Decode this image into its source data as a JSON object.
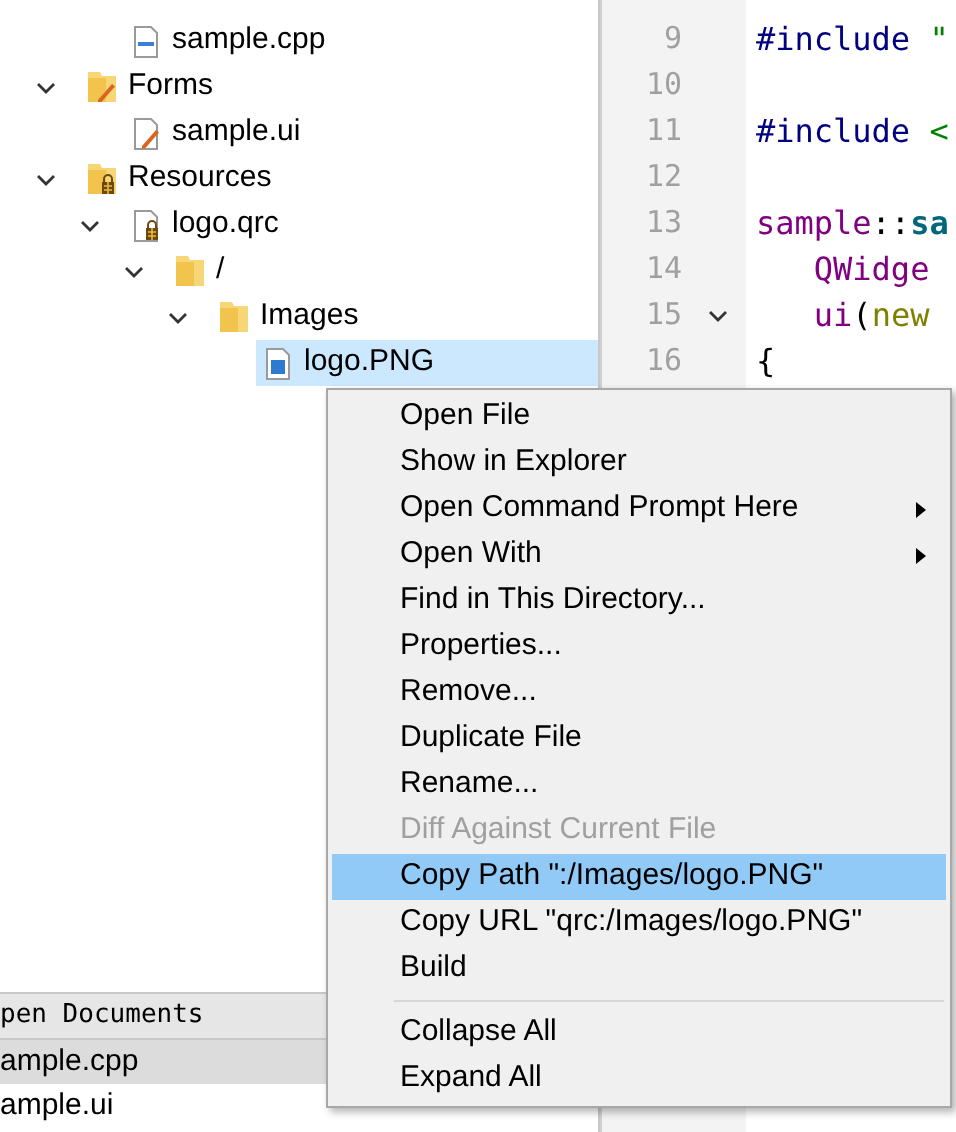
{
  "tree": {
    "continued_children": [
      {
        "label": "sample.cpp",
        "kind": "cpp",
        "selected": false
      }
    ],
    "items": [
      {
        "label": "Forms",
        "kind": "form-folder",
        "expanded": true,
        "selected": false,
        "children": [
          {
            "label": "sample.ui",
            "kind": "ui",
            "selected": false
          }
        ]
      },
      {
        "label": "Resources",
        "kind": "resource-folder",
        "expanded": true,
        "selected": false,
        "children": [
          {
            "label": "logo.qrc",
            "kind": "qrc",
            "expanded": true,
            "selected": false,
            "children": [
              {
                "label": "/",
                "kind": "folder",
                "expanded": true,
                "selected": false,
                "children": [
                  {
                    "label": "Images",
                    "kind": "folder",
                    "expanded": true,
                    "selected": false,
                    "children": [
                      {
                        "label": "logo.PNG",
                        "kind": "image",
                        "selected": true
                      }
                    ]
                  }
                ]
              }
            ]
          }
        ]
      }
    ]
  },
  "open_documents": {
    "title": "pen Documents",
    "items": [
      {
        "label": "ample.cpp",
        "selected": true
      },
      {
        "label": "ample.ui",
        "selected": false
      }
    ]
  },
  "editor": {
    "lines": [
      {
        "number": "9",
        "fold": false,
        "segments": [
          {
            "text": "#include ",
            "kind": "directive"
          },
          {
            "text": "\"",
            "kind": "string"
          }
        ]
      },
      {
        "number": "10",
        "fold": false
      },
      {
        "number": "11",
        "fold": false,
        "segments": [
          {
            "text": "#include ",
            "kind": "directive"
          },
          {
            "text": "<",
            "kind": "string"
          }
        ]
      },
      {
        "number": "12",
        "fold": false
      },
      {
        "number": "13",
        "fold": false,
        "segments": [
          {
            "text": "sample",
            "kind": "type"
          },
          {
            "text": "::",
            "kind": "plain"
          },
          {
            "text": "sa",
            "kind": "function"
          }
        ]
      },
      {
        "number": "14",
        "fold": false,
        "segments": [
          {
            "text": "   QWidge",
            "kind": "type"
          }
        ]
      },
      {
        "number": "15",
        "fold": true,
        "segments": [
          {
            "text": "   ui",
            "kind": "type"
          },
          {
            "text": "(",
            "kind": "plain"
          },
          {
            "text": "new",
            "kind": "keyword"
          }
        ]
      },
      {
        "number": "16",
        "fold": false,
        "segments": [
          {
            "text": "{",
            "kind": "plain"
          }
        ]
      }
    ]
  },
  "context_menu": [
    {
      "kind": "item",
      "label": "Open File",
      "submenu": false,
      "disabled": false,
      "selected": false
    },
    {
      "kind": "item",
      "label": "Show in Explorer",
      "submenu": false,
      "disabled": false,
      "selected": false
    },
    {
      "kind": "item",
      "label": "Open Command Prompt Here",
      "submenu": true,
      "disabled": false,
      "selected": false
    },
    {
      "kind": "item",
      "label": "Open With",
      "submenu": true,
      "disabled": false,
      "selected": false
    },
    {
      "kind": "item",
      "label": "Find in This Directory...",
      "submenu": false,
      "disabled": false,
      "selected": false
    },
    {
      "kind": "item",
      "label": "Properties...",
      "submenu": false,
      "disabled": false,
      "selected": false
    },
    {
      "kind": "item",
      "label": "Remove...",
      "submenu": false,
      "disabled": false,
      "selected": false
    },
    {
      "kind": "item",
      "label": "Duplicate File",
      "submenu": false,
      "disabled": false,
      "selected": false
    },
    {
      "kind": "item",
      "label": "Rename...",
      "submenu": false,
      "disabled": false,
      "selected": false
    },
    {
      "kind": "item",
      "label": "Diff Against Current File",
      "submenu": false,
      "disabled": true,
      "selected": false
    },
    {
      "kind": "item",
      "label": "Copy Path \":/Images/logo.PNG\"",
      "submenu": false,
      "disabled": false,
      "selected": true
    },
    {
      "kind": "item",
      "label": "Copy URL \"qrc:/Images/logo.PNG\"",
      "submenu": false,
      "disabled": false,
      "selected": false
    },
    {
      "kind": "item",
      "label": "Build",
      "submenu": false,
      "disabled": false,
      "selected": false
    },
    {
      "kind": "separator"
    },
    {
      "kind": "item",
      "label": "Collapse All",
      "submenu": false,
      "disabled": false,
      "selected": false
    },
    {
      "kind": "item",
      "label": "Expand All",
      "submenu": false,
      "disabled": false,
      "selected": false
    }
  ]
}
